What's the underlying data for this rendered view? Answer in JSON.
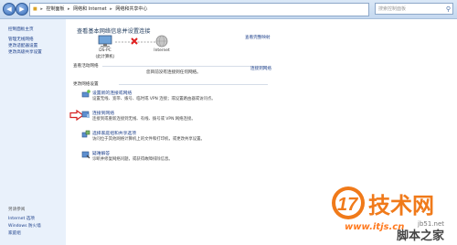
{
  "address_bar": {
    "crumbs": [
      "控制面板",
      "网络和 Internet",
      "网络和共享中心"
    ]
  },
  "search": {
    "placeholder": "搜索控制面板"
  },
  "sidebar": {
    "items": [
      {
        "label": "控制面板主页"
      },
      {
        "label": "管理无线网络"
      },
      {
        "label": "更改适配器设置"
      },
      {
        "label": "更改高级共享设置"
      }
    ],
    "see_also": "另请参阅",
    "see_items": [
      {
        "label": "Internet 选项"
      },
      {
        "label": "Windows 防火墙"
      },
      {
        "label": "家庭组"
      }
    ]
  },
  "main": {
    "title": "查看基本网络信息并设置连接",
    "full_map": "查看完整映射",
    "pc_name": "DS-PC",
    "pc_sub": "(此计算机)",
    "internet": "Internet",
    "active_label": "查看活动网络",
    "not_connected": "您目前没有连接到任何网络。",
    "connect_link": "连接到网络",
    "change_label": "更改网络设置",
    "tasks": [
      {
        "title": "设置新的连接或网络",
        "desc": "设置无线、宽带、拨号、临时或 VPN 连接；或设置路由器或访问点。"
      },
      {
        "title": "连接到网络",
        "desc": "连接到或重新连接到无线、有线、拨号或 VPN 网络连接。"
      },
      {
        "title": "选择家庭组和共享选项",
        "desc": "访问位于其他网络计算机上的文件和打印机，或更改共享设置。"
      },
      {
        "title": "疑难解答",
        "desc": "诊断并修复网络问题，或获得故障排除信息。"
      }
    ]
  },
  "watermark": {
    "logo_number": "17",
    "logo_chars": "技术网",
    "site": "www.itjs.cn",
    "site2": "jb51.net",
    "brand": "脚本之家"
  },
  "colors": {
    "link": "#1c3f8a",
    "sidebar_bg": "#e9f1fb",
    "arrow": "#d62020",
    "logo_orange": "#f07a1a"
  }
}
